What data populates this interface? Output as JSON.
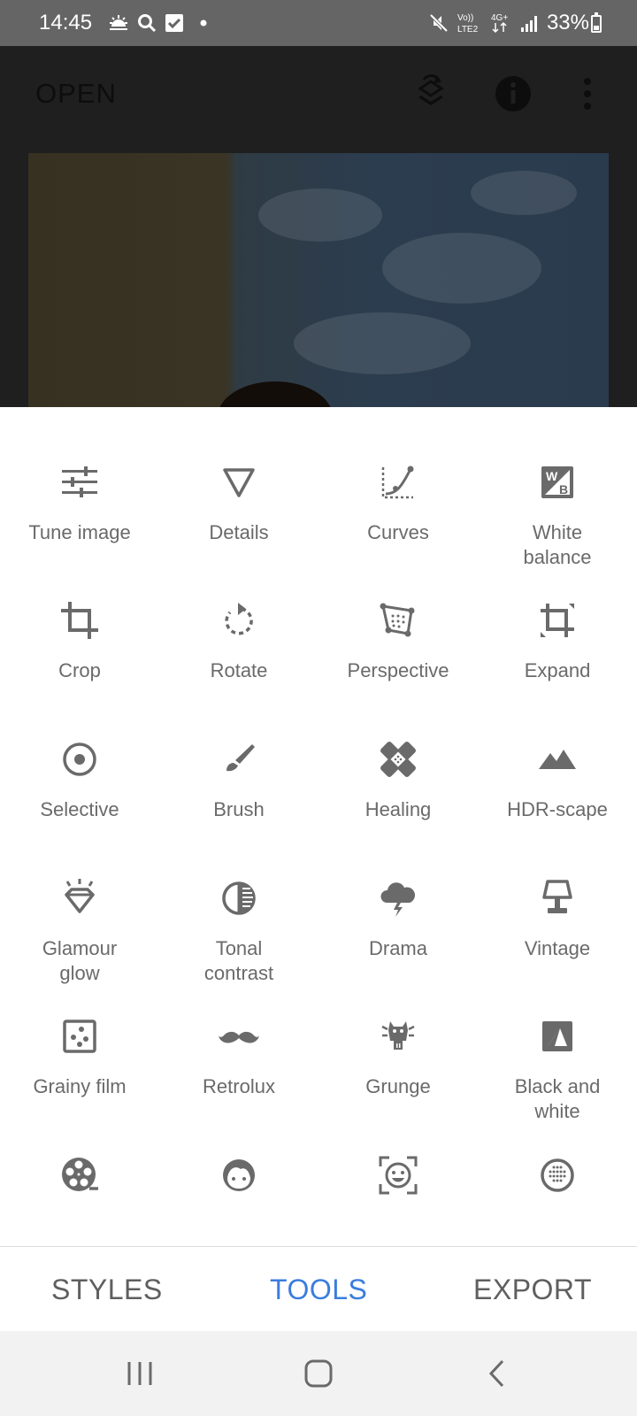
{
  "status_bar": {
    "time": "14:45",
    "battery": "33%",
    "battery_level": 0.33,
    "left_icons": [
      "weather-sunrise-icon",
      "search-icon",
      "checkbox-icon",
      "dot-icon"
    ],
    "right_icons": [
      "mute-icon",
      "volte-icon",
      "4g-icon",
      "signal-icon",
      "battery-icon"
    ],
    "volte_label": "Vo))\nLTE2",
    "net_label": "4G+"
  },
  "top_bar": {
    "open_label": "OPEN",
    "icons": [
      "layers-undo-icon",
      "info-icon",
      "more-vert-icon"
    ]
  },
  "tools": [
    {
      "label": "Tune image",
      "icon": "tune-icon"
    },
    {
      "label": "Details",
      "icon": "details-triangle-icon"
    },
    {
      "label": "Curves",
      "icon": "curves-icon"
    },
    {
      "label": "White\nbalance",
      "icon": "white-balance-icon",
      "icon_letters": [
        "W",
        "B"
      ]
    },
    {
      "label": "Crop",
      "icon": "crop-icon"
    },
    {
      "label": "Rotate",
      "icon": "rotate-icon"
    },
    {
      "label": "Perspective",
      "icon": "perspective-icon"
    },
    {
      "label": "Expand",
      "icon": "expand-icon"
    },
    {
      "label": "Selective",
      "icon": "selective-icon"
    },
    {
      "label": "Brush",
      "icon": "brush-icon"
    },
    {
      "label": "Healing",
      "icon": "healing-icon"
    },
    {
      "label": "HDR-scape",
      "icon": "mountains-icon"
    },
    {
      "label": "Glamour\nglow",
      "icon": "diamond-glow-icon"
    },
    {
      "label": "Tonal\ncontrast",
      "icon": "tonal-contrast-icon"
    },
    {
      "label": "Drama",
      "icon": "storm-cloud-icon"
    },
    {
      "label": "Vintage",
      "icon": "lamp-icon"
    },
    {
      "label": "Grainy film",
      "icon": "grain-icon"
    },
    {
      "label": "Retrolux",
      "icon": "mustache-icon"
    },
    {
      "label": "Grunge",
      "icon": "grunge-icon"
    },
    {
      "label": "Black and\nwhite",
      "icon": "black-white-icon"
    },
    {
      "label": "",
      "icon": "film-reel-icon"
    },
    {
      "label": "",
      "icon": "face-icon"
    },
    {
      "label": "",
      "icon": "face-detect-icon"
    },
    {
      "label": "",
      "icon": "lens-blur-icon"
    }
  ],
  "tabs": {
    "styles": "STYLES",
    "tools": "TOOLS",
    "export": "EXPORT",
    "active": "tools"
  },
  "colors": {
    "accent": "#3b7ddd",
    "icon_gray": "#6a6a6a",
    "tab_gray": "#5f5f5f"
  },
  "nav_bar": {
    "icons": [
      "recents-icon",
      "home-icon",
      "back-icon"
    ]
  }
}
